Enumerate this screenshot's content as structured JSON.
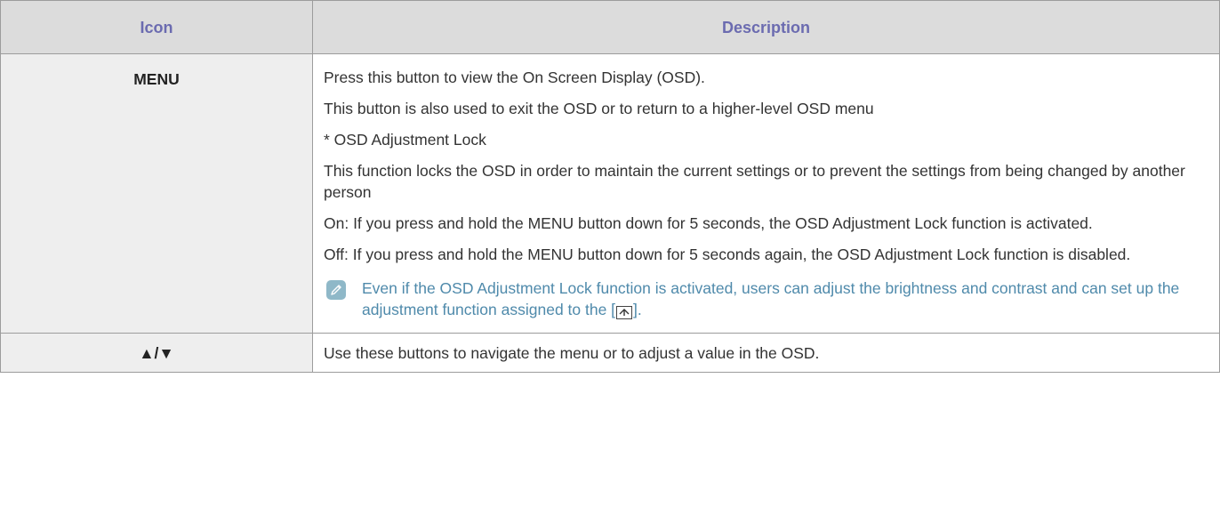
{
  "table": {
    "headers": {
      "icon": "Icon",
      "description": "Description"
    },
    "rows": [
      {
        "icon_label": "MENU",
        "paragraphs": [
          "Press this button to view the On Screen Display (OSD).",
          "This button is also used to exit the OSD or to return to a higher-level OSD menu",
          "* OSD Adjustment Lock",
          "This function locks the OSD in order to maintain the current settings or to prevent the settings from being changed by another person",
          "On: If you press and hold the MENU button down for 5 seconds, the OSD Adjustment Lock function is activated.",
          "Off: If you press and hold the MENU button down for 5 seconds again, the OSD Adjustment Lock function is disabled."
        ],
        "note": {
          "text_before": "Even if the OSD Adjustment Lock function is activated, users can adjust the brightness and contrast and can set up the adjustment function assigned to the [",
          "icon": "custom-button-icon",
          "text_after": "]."
        }
      },
      {
        "icon_label": "▲/▼",
        "paragraphs": [
          "Use these buttons to navigate the menu or to adjust a value in the OSD."
        ]
      }
    ]
  },
  "colors": {
    "header_bg": "#dcdcdc",
    "header_text": "#6b6bb0",
    "icon_col_bg": "#eeeeee",
    "border": "#9c9c9c",
    "note_text": "#4f8aab",
    "note_icon_bg": "#8fb8c8"
  }
}
